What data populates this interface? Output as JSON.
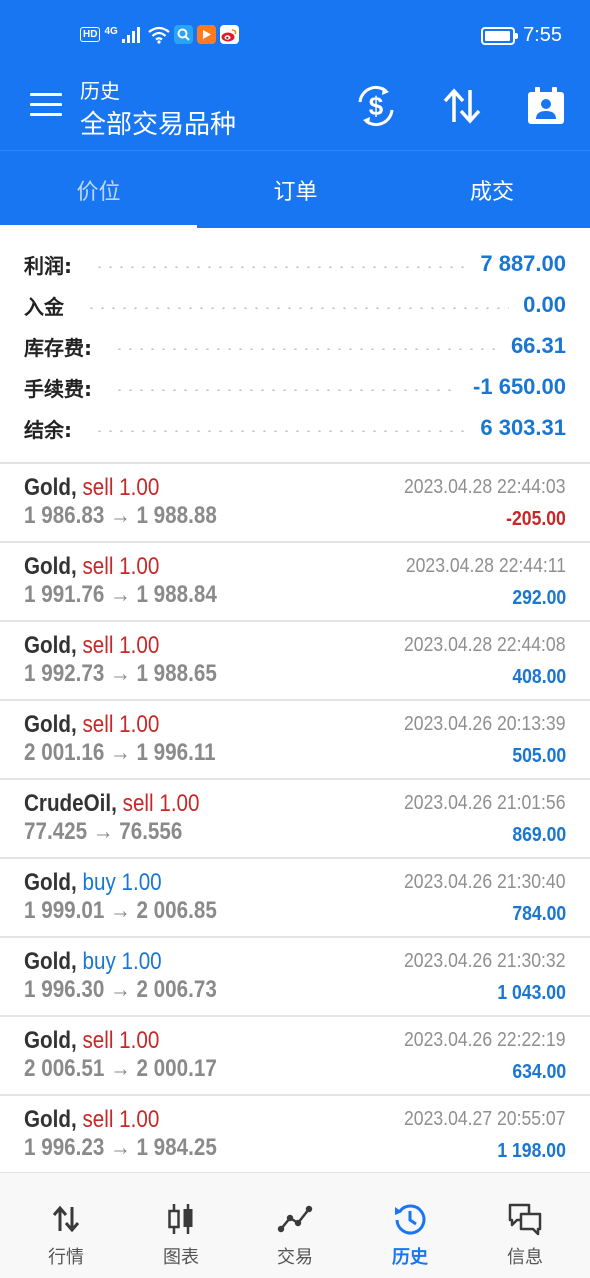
{
  "status_bar": {
    "hd": "HD",
    "network": "4G",
    "time": "7:55",
    "battery_level": 0.95,
    "app_icons": [
      "search-app-icon",
      "video-app-icon",
      "weibo-app-icon"
    ]
  },
  "header": {
    "subtitle": "历史",
    "title": "全部交易品种",
    "icons": [
      "menu-icon",
      "currency-exchange-icon",
      "sort-arrows-icon",
      "calendar-user-icon"
    ]
  },
  "tabs": [
    {
      "label": "价位",
      "active": true
    },
    {
      "label": "订单",
      "active": false
    },
    {
      "label": "成交",
      "active": false
    }
  ],
  "summary": [
    {
      "label": "利润:",
      "value": "7 887.00"
    },
    {
      "label": "入金",
      "value": "0.00"
    },
    {
      "label": "库存费:",
      "value": "66.31"
    },
    {
      "label": "手续费:",
      "value": "-1 650.00"
    },
    {
      "label": "结余:",
      "value": "6 303.31"
    }
  ],
  "trades": [
    {
      "symbol": "Gold,",
      "side": "sell 1.00",
      "side_type": "sell",
      "prices": "1 986.83 → 1 988.88",
      "time": "2023.04.28 22:44:03",
      "profit": "-205.00"
    },
    {
      "symbol": "Gold,",
      "side": "sell 1.00",
      "side_type": "sell",
      "prices": "1 991.76 → 1 988.84",
      "time": "2023.04.28 22:44:11",
      "profit": "292.00"
    },
    {
      "symbol": "Gold,",
      "side": "sell 1.00",
      "side_type": "sell",
      "prices": "1 992.73 → 1 988.65",
      "time": "2023.04.28 22:44:08",
      "profit": "408.00"
    },
    {
      "symbol": "Gold,",
      "side": "sell 1.00",
      "side_type": "sell",
      "prices": "2 001.16 → 1 996.11",
      "time": "2023.04.26 20:13:39",
      "profit": "505.00"
    },
    {
      "symbol": "CrudeOil,",
      "side": "sell 1.00",
      "side_type": "sell",
      "prices": "77.425 → 76.556",
      "time": "2023.04.26 21:01:56",
      "profit": "869.00"
    },
    {
      "symbol": "Gold,",
      "side": "buy 1.00",
      "side_type": "buy",
      "prices": "1 999.01 → 2 006.85",
      "time": "2023.04.26 21:30:40",
      "profit": "784.00"
    },
    {
      "symbol": "Gold,",
      "side": "buy 1.00",
      "side_type": "buy",
      "prices": "1 996.30 → 2 006.73",
      "time": "2023.04.26 21:30:32",
      "profit": "1 043.00"
    },
    {
      "symbol": "Gold,",
      "side": "sell 1.00",
      "side_type": "sell",
      "prices": "2 006.51 → 2 000.17",
      "time": "2023.04.26 22:22:19",
      "profit": "634.00"
    },
    {
      "symbol": "Gold,",
      "side": "sell 1.00",
      "side_type": "sell",
      "prices": "1 996.23 → 1 984.25",
      "time": "2023.04.27 20:55:07",
      "profit": "1 198.00"
    }
  ],
  "bottom_nav": [
    {
      "label": "行情",
      "icon": "quotes-arrows-icon",
      "active": false
    },
    {
      "label": "图表",
      "icon": "chart-candles-icon",
      "active": false
    },
    {
      "label": "交易",
      "icon": "trade-line-icon",
      "active": false
    },
    {
      "label": "历史",
      "icon": "history-clock-icon",
      "active": true
    },
    {
      "label": "信息",
      "icon": "messages-icon",
      "active": false
    }
  ],
  "colors": {
    "primary": "#1976f2",
    "profit_positive": "#1976d2",
    "profit_negative": "#c62828",
    "sell": "#c62828",
    "buy": "#1976d2"
  }
}
